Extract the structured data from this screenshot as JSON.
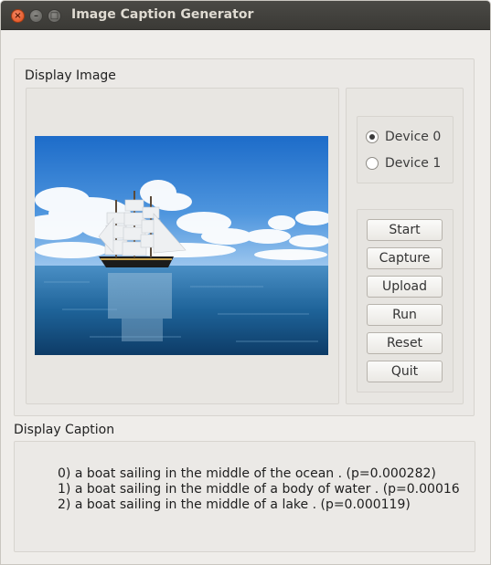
{
  "window": {
    "title": "Image Caption Generator",
    "controls": [
      "close-icon",
      "minimize-icon",
      "maximize-icon"
    ]
  },
  "display_image": {
    "label": "Display Image"
  },
  "devices": {
    "options": [
      {
        "label": "Device 0",
        "selected": true
      },
      {
        "label": "Device 1",
        "selected": false
      }
    ]
  },
  "buttons": {
    "start": "Start",
    "capture": "Capture",
    "upload": "Upload",
    "run": "Run",
    "reset": "Reset",
    "quit": "Quit"
  },
  "display_caption": {
    "label": "Display Caption",
    "lines": [
      "0) a boat sailing in the middle of the ocean . (p=0.000282)",
      "1) a boat sailing in the middle of a body of water . (p=0.00016",
      "2) a boat sailing in the middle of a lake . (p=0.000119)"
    ]
  },
  "colors": {
    "titlebar": "#3f3e3a",
    "window_bg": "#efedea",
    "close_button": "#e9541c"
  }
}
